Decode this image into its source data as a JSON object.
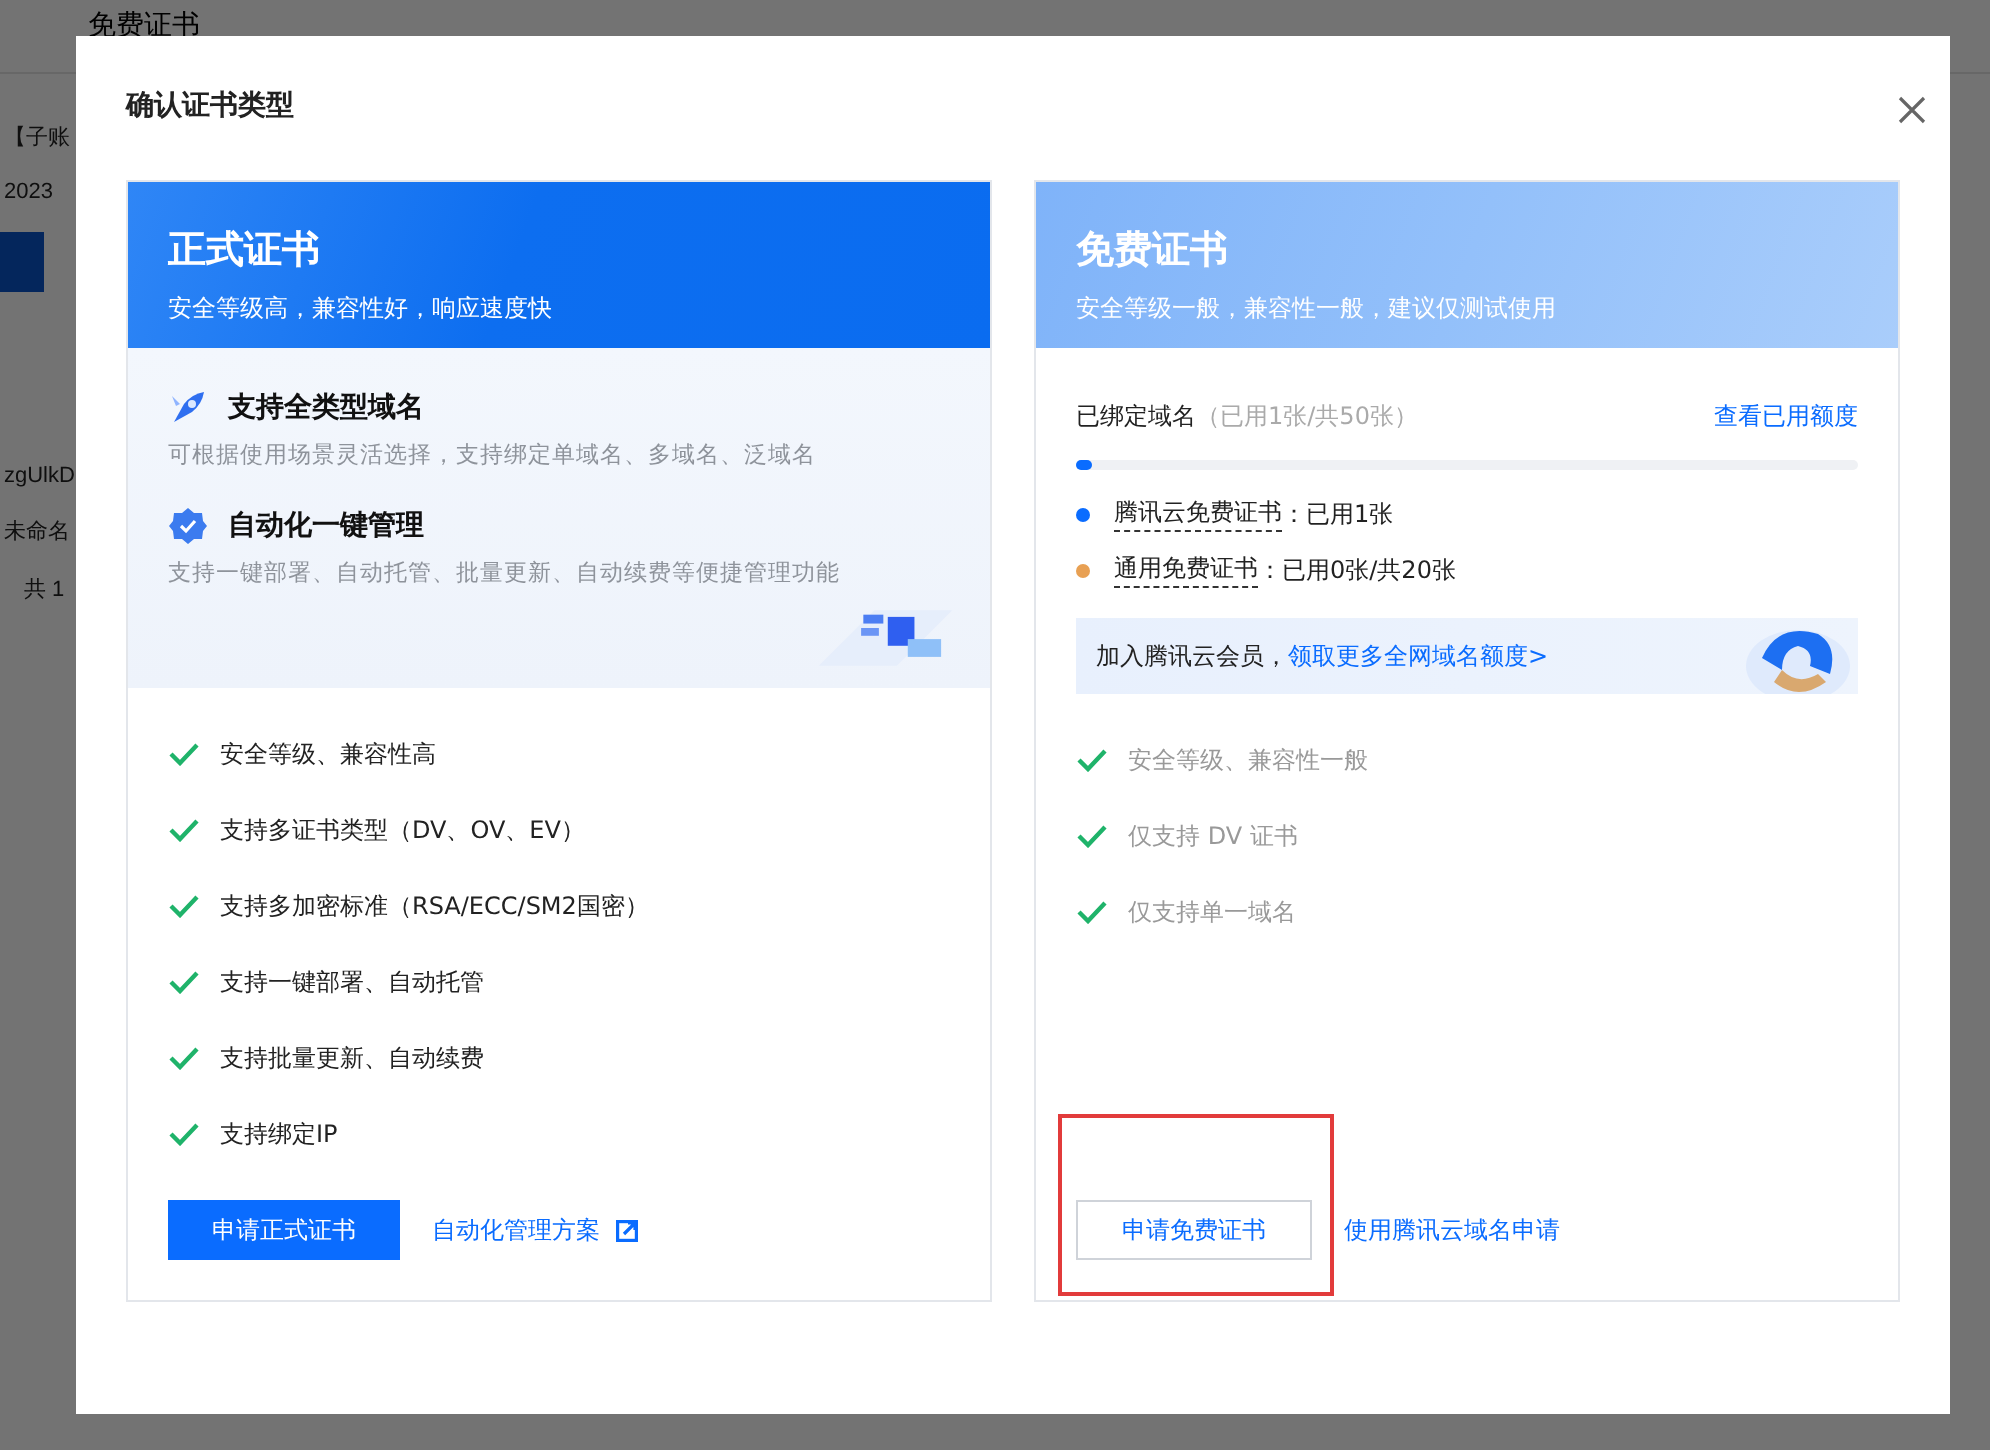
{
  "background": {
    "tab": {
      "label": "免费证书",
      "selected": true
    },
    "texts": [
      "【子账",
      "2023",
      "zgUlkD",
      "未命名",
      "共 1"
    ]
  },
  "dialog": {
    "title": "确认证书类型",
    "cards": [
      {
        "kind": "paid",
        "title": "正式证书",
        "subtitle": "安全等级高，兼容性好，响应速度快",
        "features": [
          {
            "title": "支持全类型域名",
            "description": "可根据使用场景灵活选择，支持绑定单域名、多域名、泛域名"
          },
          {
            "title": "自动化一键管理",
            "description": "支持一键部署、自动托管、批量更新、自动续费等便捷管理功能"
          }
        ],
        "checklist": [
          "安全等级、兼容性高",
          "支持多证书类型（DV、OV、EV）",
          "支持多加密标准（RSA/ECC/SM2国密）",
          "支持一键部署、自动托管",
          "支持批量更新、自动续费",
          "支持绑定IP"
        ],
        "button": {
          "label": "申请正式证书",
          "primary": true
        },
        "link": "自动化管理方案"
      },
      {
        "kind": "free",
        "title": "免费证书",
        "subtitle": "安全等级一般，兼容性一般，建议仅测试使用",
        "quota": {
          "label": "已绑定域名",
          "detail": "（已用1张/共50张）",
          "link": "查看已用额度",
          "level": 0.02,
          "legend": [
            {
              "label": "腾讯云免费证书",
              "value": "：已用1张",
              "color": "#0a6cff"
            },
            {
              "label": "通用免费证书",
              "value": "：已用0张/共20张",
              "color": "#e8a053"
            }
          ]
        },
        "promo": {
          "text": "加入腾讯云会员，",
          "link": "领取更多全网域名额度>"
        },
        "checklist": [
          "安全等级、兼容性一般",
          "仅支持 DV 证书",
          "仅支持单一域名"
        ],
        "button": {
          "label": "申请免费证书",
          "primary": false
        },
        "link": "使用腾讯云域名申请"
      }
    ]
  }
}
